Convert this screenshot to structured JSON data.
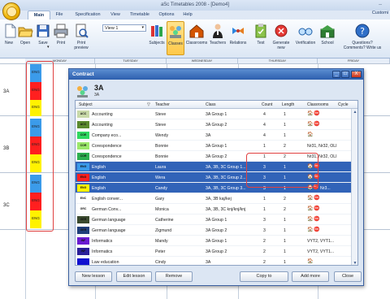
{
  "app": {
    "title": "aSc Timetables 2008 - [Demo4]",
    "minimize_glyph": "–",
    "customize_label": "Customi"
  },
  "tabs": [
    {
      "label": "Main",
      "active": true
    },
    {
      "label": "File"
    },
    {
      "label": "Specification"
    },
    {
      "label": "View"
    },
    {
      "label": "Timetable"
    },
    {
      "label": "Options"
    },
    {
      "label": "Help"
    }
  ],
  "ribbon": {
    "view_select_value": "View 1",
    "buttons": {
      "new": "New",
      "open": "Open",
      "save": "Save",
      "print": "Print",
      "print_preview_1": "Print",
      "print_preview_2": "preview",
      "subjects": "Subjects",
      "classes": "Classes",
      "classrooms": "Classrooms",
      "teachers": "Teachers",
      "relations": "Relations",
      "test": "Test",
      "generate_1": "Generate",
      "generate_2": "new",
      "verification": "Verification",
      "school": "School",
      "questions_1": "Questions?",
      "questions_2": "Comments? Write us"
    }
  },
  "timetable": {
    "days": [
      "MONDAY",
      "TUESDAY",
      "WEDNESDAY",
      "THURSDAY",
      "FRIDAY"
    ],
    "classes": [
      "3A",
      "3B",
      "3C"
    ],
    "card_label": "ENG",
    "colors": {
      "blue": "#3b9bea",
      "red": "#ff1f1f",
      "yellow": "#fff200",
      "highlight": "#e04040"
    }
  },
  "dialog": {
    "title": "Contract",
    "controls": {
      "minimize": "_",
      "maximize": "□",
      "close": "X"
    },
    "class_name": "3A",
    "class_short": "3A",
    "columns": [
      "Subject",
      "Teacher",
      "Class",
      "Count",
      "Length",
      "Classrooms",
      "Cycle"
    ],
    "rows": [
      {
        "icon": "ACC",
        "icolor": "#c8d9a8",
        "subject": "Accounting",
        "teacher": "Steve",
        "class": "3A Group 1",
        "count": "4",
        "length": "1",
        "classrooms": "",
        "rooms": [
          "🏠",
          "⛔"
        ],
        "selected": false
      },
      {
        "icon": "ACC",
        "icolor": "#5b8a2e",
        "subject": "Accounting",
        "teacher": "Steve",
        "class": "3A Group 2",
        "count": "4",
        "length": "1",
        "classrooms": "",
        "rooms": [
          "🏠",
          "⛔"
        ],
        "selected": false
      },
      {
        "icon": "COE",
        "icolor": "#2fd860",
        "subject": "Company eco...",
        "teacher": "Wendy",
        "class": "3A",
        "count": "4",
        "length": "1",
        "classrooms": "",
        "rooms": [
          "🏠"
        ],
        "selected": false
      },
      {
        "icon": "COR",
        "icolor": "#9be86a",
        "subject": "Corespondence",
        "teacher": "Bonnie",
        "class": "3A Group 1",
        "count": "1",
        "length": "2",
        "classrooms": "Nr31, Nr32, OLI",
        "rooms": [],
        "selected": false
      },
      {
        "icon": "COR",
        "icolor": "#2db050",
        "subject": "Corespondence",
        "teacher": "Bonnie",
        "class": "3A Group 2",
        "count": "1",
        "length": "2",
        "classrooms": "Nr31, Nr32, OLI",
        "rooms": [],
        "selected": false
      },
      {
        "icon": "ENG",
        "icolor": "#3b9bea",
        "subject": "English",
        "teacher": "Laura",
        "class": "3A, 3B, 3C Group 1...",
        "count": "3",
        "length": "1",
        "classrooms": "",
        "rooms": [
          "🏠",
          "⛔"
        ],
        "selected": true
      },
      {
        "icon": "ENG",
        "icolor": "#ff1f1f",
        "subject": "English",
        "teacher": "Wera",
        "class": "3A, 3B, 3C Group 2...",
        "count": "3",
        "length": "1",
        "classrooms": "",
        "rooms": [
          "🏠",
          "⛔"
        ],
        "selected": true
      },
      {
        "icon": "ENG",
        "icolor": "#fff200",
        "subject": "English",
        "teacher": "Candy",
        "class": "3A, 3B, 3C Group 3...",
        "count": "3",
        "length": "1",
        "classrooms": "Nr3...",
        "rooms": [
          "🏠",
          "⛔"
        ],
        "selected": true
      },
      {
        "icon": "ENC",
        "icolor": "#ffffff",
        "subject": "English conver...",
        "teacher": "Gary",
        "class": "3A, 3B kaj/kej",
        "count": "1",
        "length": "2",
        "classrooms": "",
        "rooms": [
          "🏠",
          "⛔"
        ],
        "selected": false
      },
      {
        "icon": "GRC",
        "icolor": "#ffffff",
        "subject": "German Conv...",
        "teacher": "Monica",
        "class": "3A, 3B, 3C knj/knj/knj",
        "count": "1",
        "length": "2",
        "classrooms": "",
        "rooms": [
          "🏠",
          "⛔"
        ],
        "selected": false
      },
      {
        "icon": "GER",
        "icolor": "#3a4a2e",
        "subject": "German language",
        "teacher": "Catherine",
        "class": "3A Group 1",
        "count": "3",
        "length": "1",
        "classrooms": "",
        "rooms": [
          "🏠",
          "⛔"
        ],
        "selected": false
      },
      {
        "icon": "GER",
        "icolor": "#1f3f7a",
        "subject": "German language",
        "teacher": "Zigmund",
        "class": "3A Group 2",
        "count": "3",
        "length": "1",
        "classrooms": "",
        "rooms": [
          "🏠",
          "⛔"
        ],
        "selected": false
      },
      {
        "icon": "INF",
        "icolor": "#6a1bd1",
        "subject": "Informatics",
        "teacher": "Mandy",
        "class": "3A Group 1",
        "count": "2",
        "length": "1",
        "classrooms": "VYT2, VYT1...",
        "rooms": [],
        "selected": false
      },
      {
        "icon": "INF",
        "icolor": "#2a1f9a",
        "subject": "Informatics",
        "teacher": "Peter",
        "class": "3A Group 2",
        "count": "2",
        "length": "1",
        "classrooms": "VYT2, VYT1...",
        "rooms": [],
        "selected": false
      },
      {
        "icon": "",
        "icolor": "#1010d0",
        "subject": "Law education",
        "teacher": "Cindy",
        "class": "3A",
        "count": "2",
        "length": "1",
        "classrooms": "",
        "rooms": [
          "🏠"
        ],
        "selected": false
      }
    ],
    "buttons": {
      "new_lesson": "New lesson",
      "edit_lesson": "Edit lesson",
      "remove": "Remove",
      "copy_to": "Copy to",
      "add_more": "Add more",
      "close": "Close"
    }
  }
}
